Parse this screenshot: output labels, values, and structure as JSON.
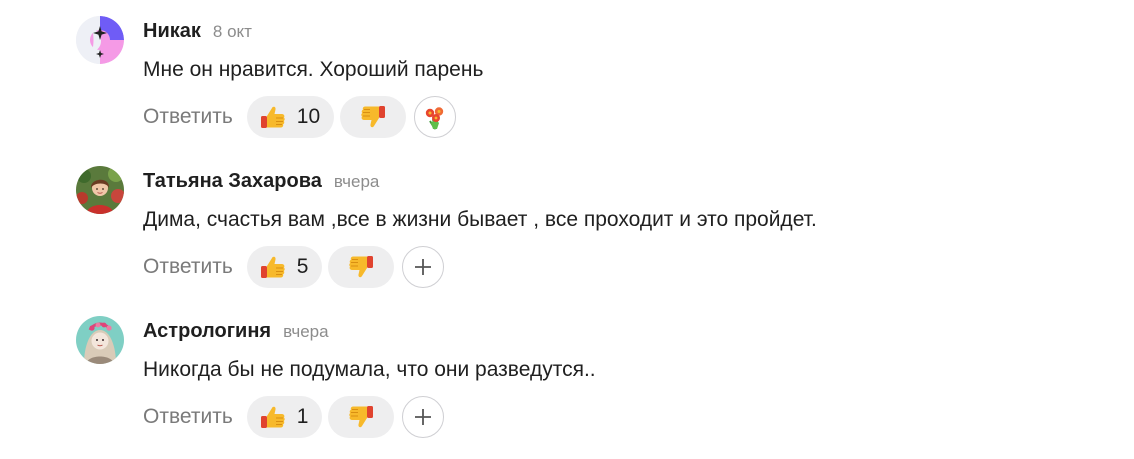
{
  "comments": [
    {
      "author": "Никак",
      "date": "8 окт",
      "text": "Мне он нравится. Хороший парень",
      "reply_label": "Ответить",
      "likes": "10",
      "extra_reaction_icon": "flowers-bouquet-icon"
    },
    {
      "author": "Татьяна Захарова",
      "date": "вчера",
      "text": "Дима, счастья вам ,все в жизни бывает , все проходит и это пройдет.",
      "reply_label": "Ответить",
      "likes": "5",
      "extra_reaction_icon": "plus-icon"
    },
    {
      "author": "Астрологиня",
      "date": "вчера",
      "text": "Никогда бы не подумала, что они разведутся..",
      "reply_label": "Ответить",
      "likes": "1",
      "extra_reaction_icon": "plus-icon"
    }
  ],
  "colors": {
    "pill_bg": "#eeeeef",
    "muted_text": "#7a7a7a",
    "date_text": "#8c8c8c",
    "thumb_yellow": "#f7b92b",
    "cuff_red": "#e0432f"
  }
}
